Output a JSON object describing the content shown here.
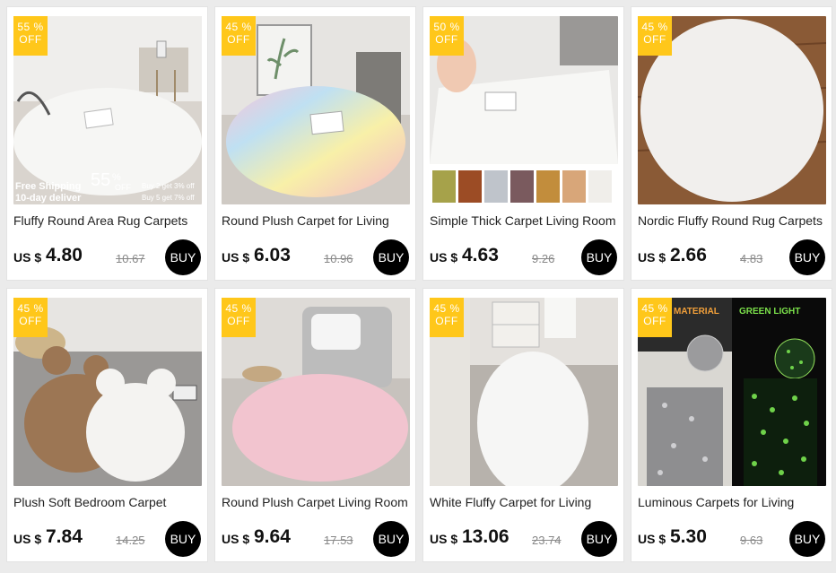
{
  "currency_label": "US $",
  "buy_label": "BUY",
  "badge_off": "OFF",
  "colors": {
    "badge": "#ffc71a",
    "buy_button": "#000000",
    "promo_banner": "#c8102e"
  },
  "products": [
    {
      "title": "Fluffy Round Area Rug Carpets",
      "price": "4.80",
      "original_price": "10.67",
      "discount": "55 %",
      "promo": {
        "free_shipping": "Free Shipping",
        "delivery": "10-day deliver",
        "percent": "55",
        "percent_suffix": "%",
        "off": "OFF",
        "line1": "Buy 2 get 3% off",
        "line2": "Buy 5 get 7% off"
      }
    },
    {
      "title": "Round Plush Carpet for Living",
      "price": "6.03",
      "original_price": "10.96",
      "discount": "45 %"
    },
    {
      "title": "Simple Thick Carpet Living Room",
      "price": "4.63",
      "original_price": "9.26",
      "discount": "50 %"
    },
    {
      "title": "Nordic Fluffy Round Rug Carpets",
      "price": "2.66",
      "original_price": "4.83",
      "discount": "45 %"
    },
    {
      "title": "Plush Soft Bedroom Carpet",
      "price": "7.84",
      "original_price": "14.25",
      "discount": "45 %"
    },
    {
      "title": "Round Plush Carpet Living Room",
      "price": "9.64",
      "original_price": "17.53",
      "discount": "45 %"
    },
    {
      "title": "White Fluffy Carpet for Living",
      "price": "13.06",
      "original_price": "23.74",
      "discount": "45 %"
    },
    {
      "title": "Luminous Carpets for Living",
      "price": "5.30",
      "original_price": "9.63",
      "discount": "45 %",
      "image_text": {
        "left": "MATERIAL",
        "right": "GREEN LIGHT"
      }
    }
  ]
}
